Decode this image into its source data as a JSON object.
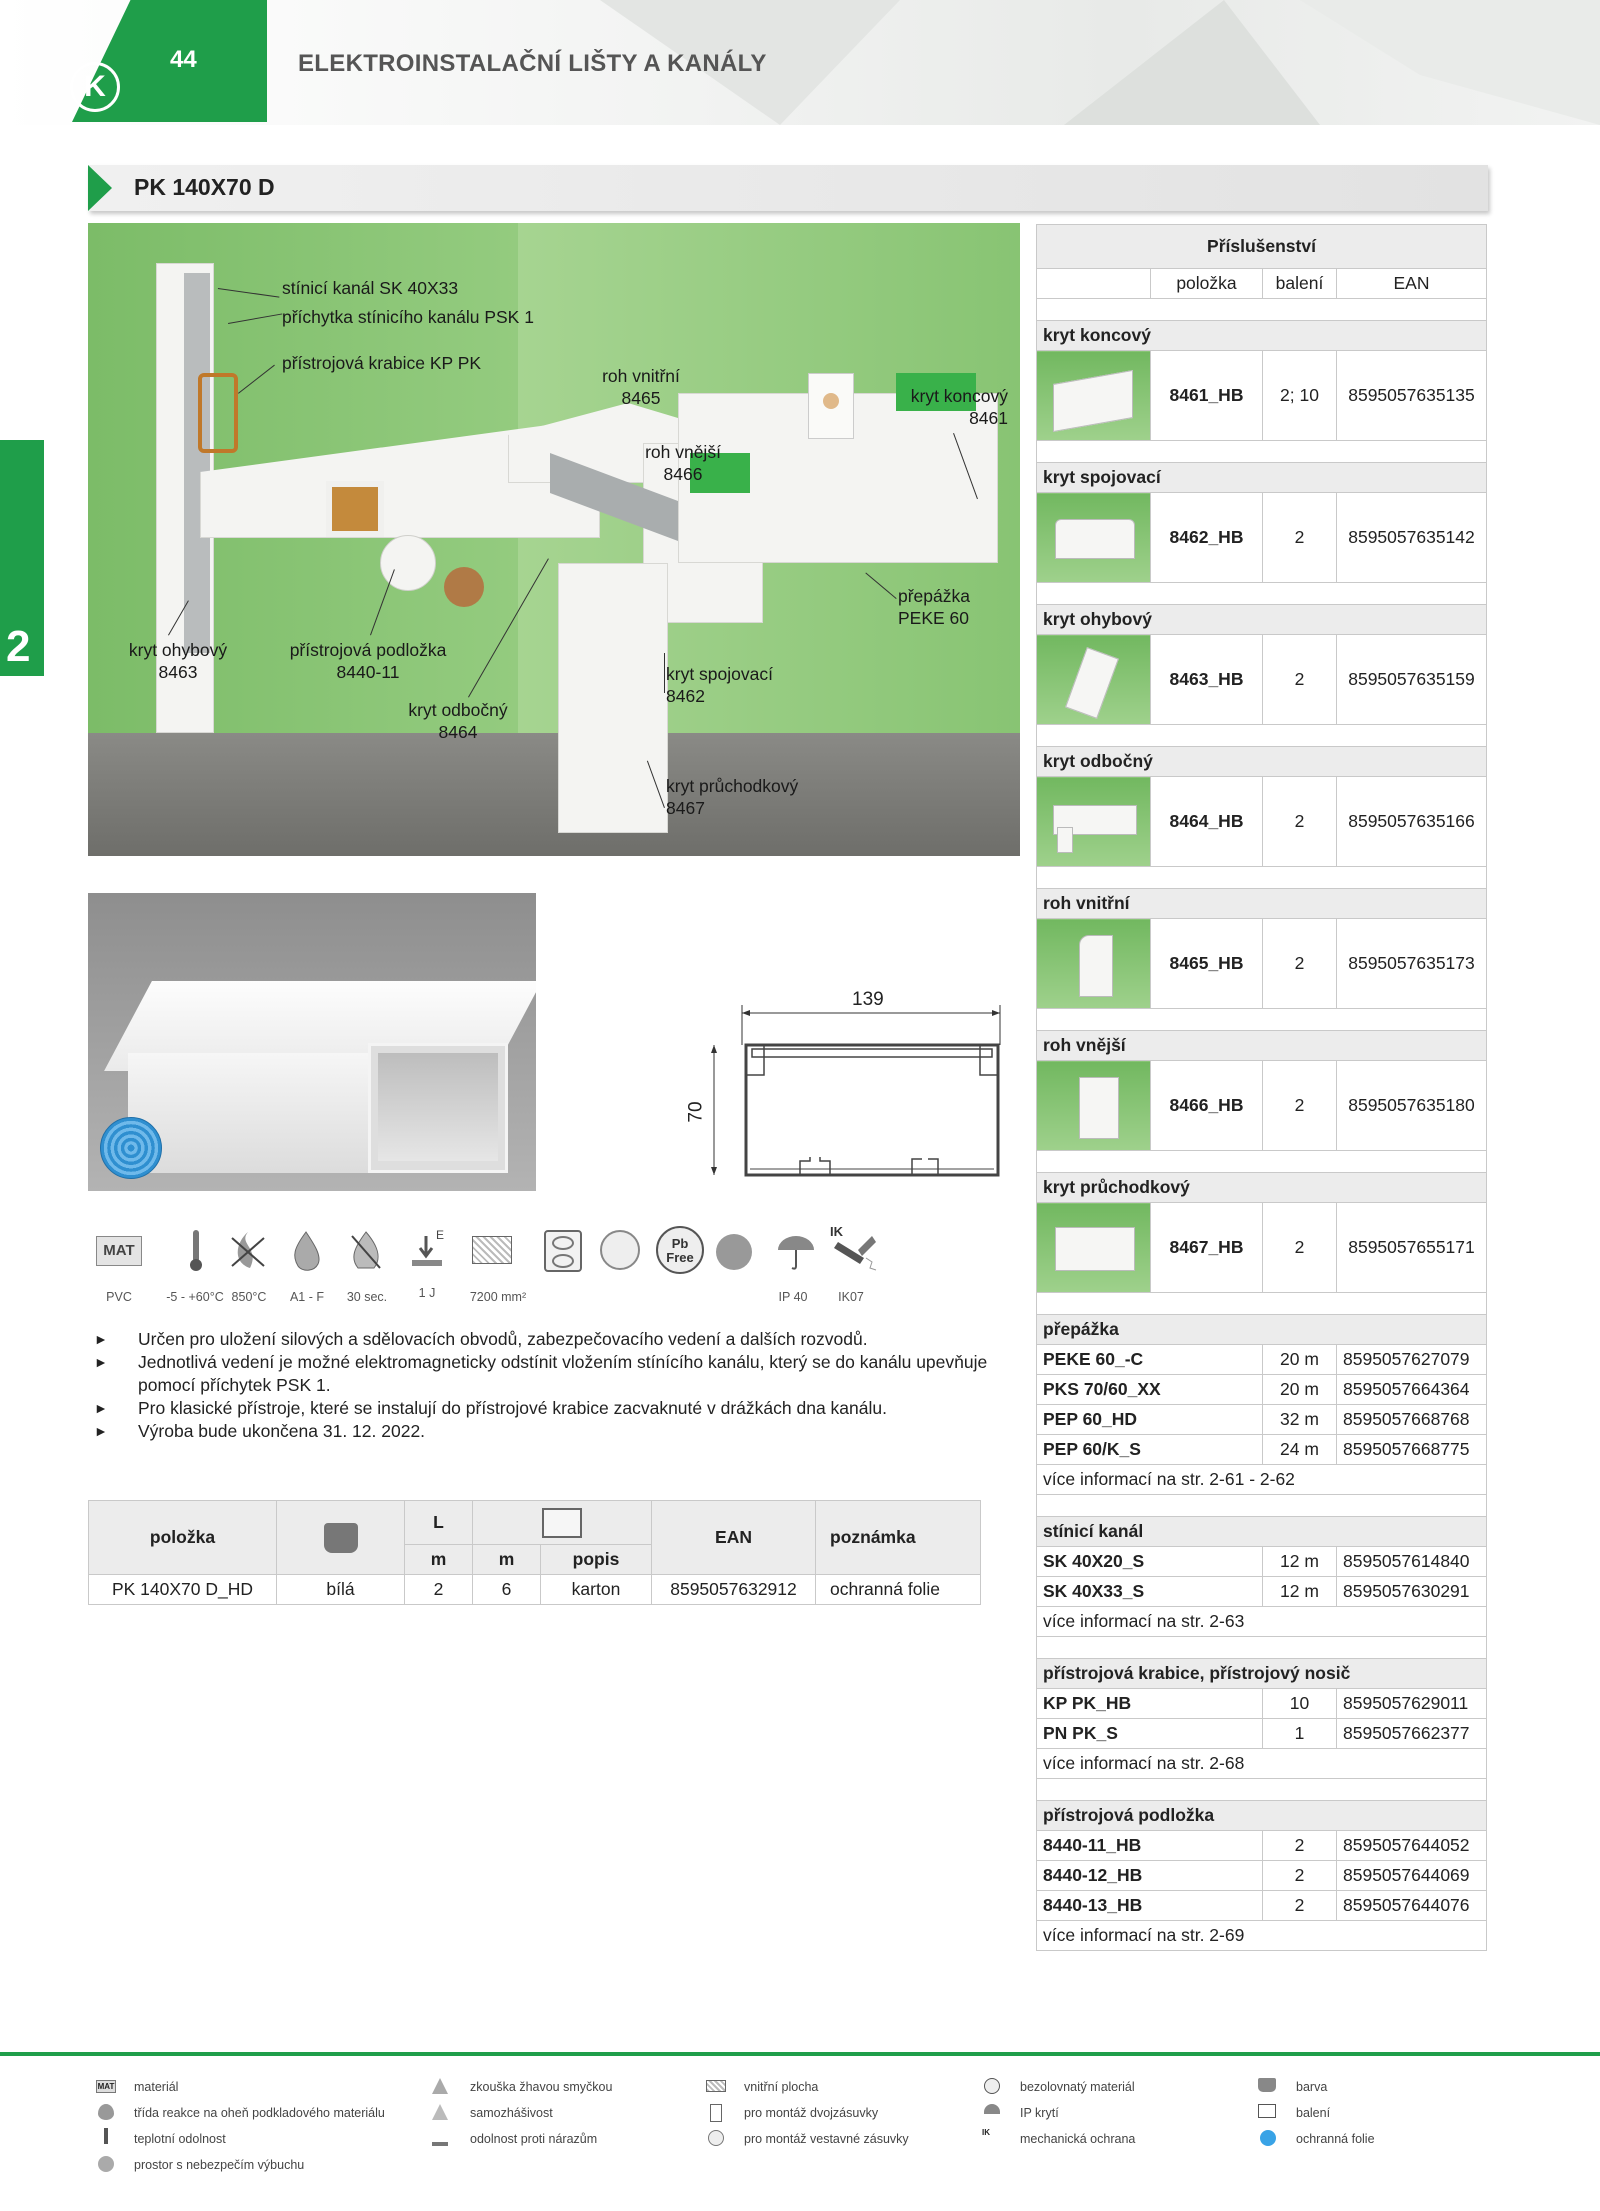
{
  "header": {
    "page_number": "44",
    "logo": "K",
    "title": "ELEKTROINSTALAČNÍ LIŠTY A KANÁLY",
    "side_tab": "2",
    "product_title": "PK 140X70 D"
  },
  "illustration_labels": {
    "stinici_kanal": "stínicí kanál SK 40X33",
    "prichytka": "příchytka stínicího kanálu PSK 1",
    "pristrojova_krabice": "přístrojová krabice KP PK",
    "roh_vnitrni": "roh vnitřní",
    "roh_vnitrni_code": "8465",
    "kryt_koncovy": "kryt koncový",
    "kryt_koncovy_code": "8461",
    "roh_vnejsi": "roh vnější",
    "roh_vnejsi_code": "8466",
    "prepazka": "přepážka",
    "prepazka_code": "PEKE 60",
    "kryt_ohybovy": "kryt ohybový",
    "kryt_ohybovy_code": "8463",
    "pristrojova_podlozka": "přístrojová podložka",
    "pristrojova_podlozka_code": "8440-11",
    "kryt_odbocny": "kryt odbočný",
    "kryt_odbocny_code": "8464",
    "kryt_spojovaci": "kryt spojovací",
    "kryt_spojovaci_code": "8462",
    "kryt_pruchodkovy": "kryt průchodkový",
    "kryt_pruchodkovy_code": "8467"
  },
  "drawing": {
    "width": "139",
    "height": "70"
  },
  "icons": [
    {
      "name": "mat-icon",
      "label": "MAT",
      "caption": "PVC"
    },
    {
      "name": "thermometer-icon",
      "caption": "-5 - +60°C"
    },
    {
      "name": "glow-wire-icon",
      "caption": "850°C"
    },
    {
      "name": "flame-drop-icon",
      "caption": "A1 - F"
    },
    {
      "name": "self-extinguish-icon",
      "caption": "30 sec."
    },
    {
      "name": "impact-icon",
      "label": "E",
      "caption": "1 J"
    },
    {
      "name": "inner-area-icon",
      "caption": "7200 mm²"
    },
    {
      "name": "double-socket-icon",
      "caption": ""
    },
    {
      "name": "built-in-socket-icon",
      "caption": ""
    },
    {
      "name": "pb-free-icon",
      "label": "Pb Free",
      "caption": ""
    },
    {
      "name": "explosion-icon",
      "caption": ""
    },
    {
      "name": "ip-umbrella-icon",
      "caption": "IP 40"
    },
    {
      "name": "ik-hammer-icon",
      "label": "IK",
      "caption": "IK07"
    }
  ],
  "bullets": [
    "Určen pro uložení silových a sdělovacích obvodů, zabezpečovacího vedení a dalších rozvodů.",
    "Jednotlivá vedení je možné elektromagneticky odstínit vložením stínícího kanálu, který se do kanálu upevňuje pomocí příchytek PSK 1.",
    "Pro klasické přístroje, které se instalují do přístrojové krabice zacvaknuté v drážkách dna kanálu.",
    "Výroba bude ukončena 31. 12. 2022."
  ],
  "product_table": {
    "headers": {
      "polozka": "položka",
      "l": "L",
      "m1": "m",
      "m2": "m",
      "popis": "popis",
      "ean": "EAN",
      "poznamka": "poznámka"
    },
    "row": {
      "polozka": "PK 140X70 D_HD",
      "barva": "bílá",
      "l": "2",
      "baleni": "6",
      "popis": "karton",
      "ean": "8595057632912",
      "poznamka": "ochranná folie"
    }
  },
  "accessories": {
    "title": "Příslušenství",
    "headers": {
      "polozka": "položka",
      "baleni": "balení",
      "ean": "EAN"
    },
    "image_items": [
      {
        "section": "kryt koncový",
        "code": "8461_HB",
        "baleni": "2; 10",
        "ean": "8595057635135"
      },
      {
        "section": "kryt spojovací",
        "code": "8462_HB",
        "baleni": "2",
        "ean": "8595057635142"
      },
      {
        "section": "kryt ohybový",
        "code": "8463_HB",
        "baleni": "2",
        "ean": "8595057635159"
      },
      {
        "section": "kryt odbočný",
        "code": "8464_HB",
        "baleni": "2",
        "ean": "8595057635166"
      },
      {
        "section": "roh vnitřní",
        "code": "8465_HB",
        "baleni": "2",
        "ean": "8595057635173"
      },
      {
        "section": "roh vnější",
        "code": "8466_HB",
        "baleni": "2",
        "ean": "8595057635180"
      },
      {
        "section": "kryt průchodkový",
        "code": "8467_HB",
        "baleni": "2",
        "ean": "8595057655171"
      }
    ],
    "prepazka": {
      "section": "přepážka",
      "rows": [
        {
          "code": "PEKE 60_-C",
          "baleni": "20 m",
          "ean": "8595057627079"
        },
        {
          "code": "PKS 70/60_XX",
          "baleni": "20 m",
          "ean": "8595057664364"
        },
        {
          "code": "PEP 60_HD",
          "baleni": "32 m",
          "ean": "8595057668768"
        },
        {
          "code": "PEP 60/K_S",
          "baleni": "24 m",
          "ean": "8595057668775"
        }
      ],
      "note": "více informací na str. 2-61 - 2-62"
    },
    "stinici": {
      "section": "stínicí kanál",
      "rows": [
        {
          "code": "SK 40X20_S",
          "baleni": "12 m",
          "ean": "8595057614840"
        },
        {
          "code": "SK 40X33_S",
          "baleni": "12 m",
          "ean": "8595057630291"
        }
      ],
      "note": "více informací na str. 2-63"
    },
    "krabice": {
      "section": "přístrojová krabice, přístrojový nosič",
      "rows": [
        {
          "code": "KP PK_HB",
          "baleni": "10",
          "ean": "8595057629011"
        },
        {
          "code": "PN PK_S",
          "baleni": "1",
          "ean": "8595057662377"
        }
      ],
      "note": "více informací na str. 2-68"
    },
    "podlozka": {
      "section": "přístrojová podložka",
      "rows": [
        {
          "code": "8440-11_HB",
          "baleni": "2",
          "ean": "8595057644052"
        },
        {
          "code": "8440-12_HB",
          "baleni": "2",
          "ean": "8595057644069"
        },
        {
          "code": "8440-13_HB",
          "baleni": "2",
          "ean": "8595057644076"
        }
      ],
      "note": "více informací na str. 2-69"
    }
  },
  "legend": {
    "c1": [
      "materiál",
      "třída reakce na oheň podkladového materiálu",
      "teplotní odolnost",
      "prostor s nebezpečím výbuchu"
    ],
    "c2": [
      "zkouška žhavou smyčkou",
      "samozhášivost",
      "odolnost proti nárazům"
    ],
    "c3": [
      "vnitřní plocha",
      "pro montáž dvojzásuvky",
      "pro montáž vestavné zásuvky"
    ],
    "c4": [
      "bezolovnatý materiál",
      "IP krytí",
      "mechanická ochrana"
    ],
    "c5": [
      "barva",
      "balení",
      "ochranná folie"
    ],
    "mat_icon": "MAT",
    "ik_icon": "IK"
  },
  "colors": {
    "brand_green": "#1f9e4a",
    "wall_green": "#7fbf6c",
    "table_header": "#ececec"
  }
}
